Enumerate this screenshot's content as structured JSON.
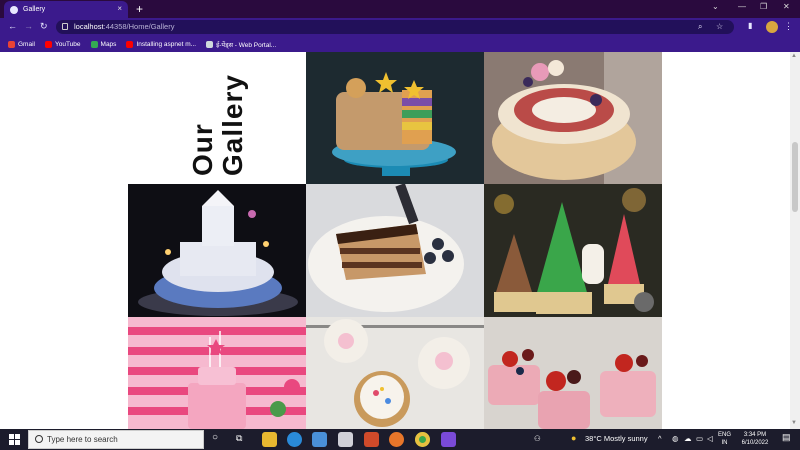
{
  "browser": {
    "tab_title": "Gallery",
    "tab_close": "×",
    "new_tab": "+",
    "url_host": "localhost",
    "url_rest": ":44358/Home/Gallery",
    "bookmarks": [
      {
        "label": "Gmail",
        "icon": "gmail-icon",
        "color": "#ea4335"
      },
      {
        "label": "YouTube",
        "icon": "youtube-icon",
        "color": "#ff0000"
      },
      {
        "label": "Maps",
        "icon": "maps-icon",
        "color": "#34a853"
      },
      {
        "label": "Installing aspnet m...",
        "icon": "youtube-icon",
        "color": "#ff0000"
      },
      {
        "label": "ई-पेंड्स - Web Portal...",
        "icon": "portal-icon",
        "color": "#cfd8dc"
      }
    ]
  },
  "page": {
    "gallery_title": "Our Gallery",
    "photos": [
      {
        "name": "rainbow-sprinkle-cake",
        "bg": "#1d2a30",
        "main": "#b98a5c",
        "accent": "#4aa3c9"
      },
      {
        "name": "berry-crown-cake",
        "bg": "#7a6a62",
        "main": "#e4c99a",
        "accent": "#c43a3a"
      },
      {
        "name": "castle-birthday-cake",
        "bg": "#0e0e14",
        "main": "#d7dbe8",
        "accent": "#6f8fc9"
      },
      {
        "name": "chocolate-layer-slice",
        "bg": "#d9dadd",
        "main": "#5a3420",
        "accent": "#f2efe8"
      },
      {
        "name": "christmas-cupcakes",
        "bg": "#2a2a22",
        "main": "#3aa64a",
        "accent": "#c23a3a"
      },
      {
        "name": "pink-party-cake",
        "bg": "#e9487f",
        "main": "#f6b9cf",
        "accent": "#ffffff"
      },
      {
        "name": "sprinkle-cupcakes",
        "bg": "#e8e6e2",
        "main": "#f3efe8",
        "accent": "#c99a5c"
      },
      {
        "name": "strawberry-petit-fours",
        "bg": "#d8d4cf",
        "main": "#e9a3b1",
        "accent": "#c2261f"
      }
    ]
  },
  "taskbar": {
    "search_placeholder": "Type here to search",
    "weather": "38°C  Mostly sunny",
    "lang_top": "ENG",
    "lang_bottom": "IN",
    "time": "3:34 PM",
    "date": "6/10/2022"
  },
  "colors": {
    "browser_frame": "#3b1a8c",
    "title_bar": "#2a0a3e",
    "taskbar": "#1c1c2c"
  }
}
